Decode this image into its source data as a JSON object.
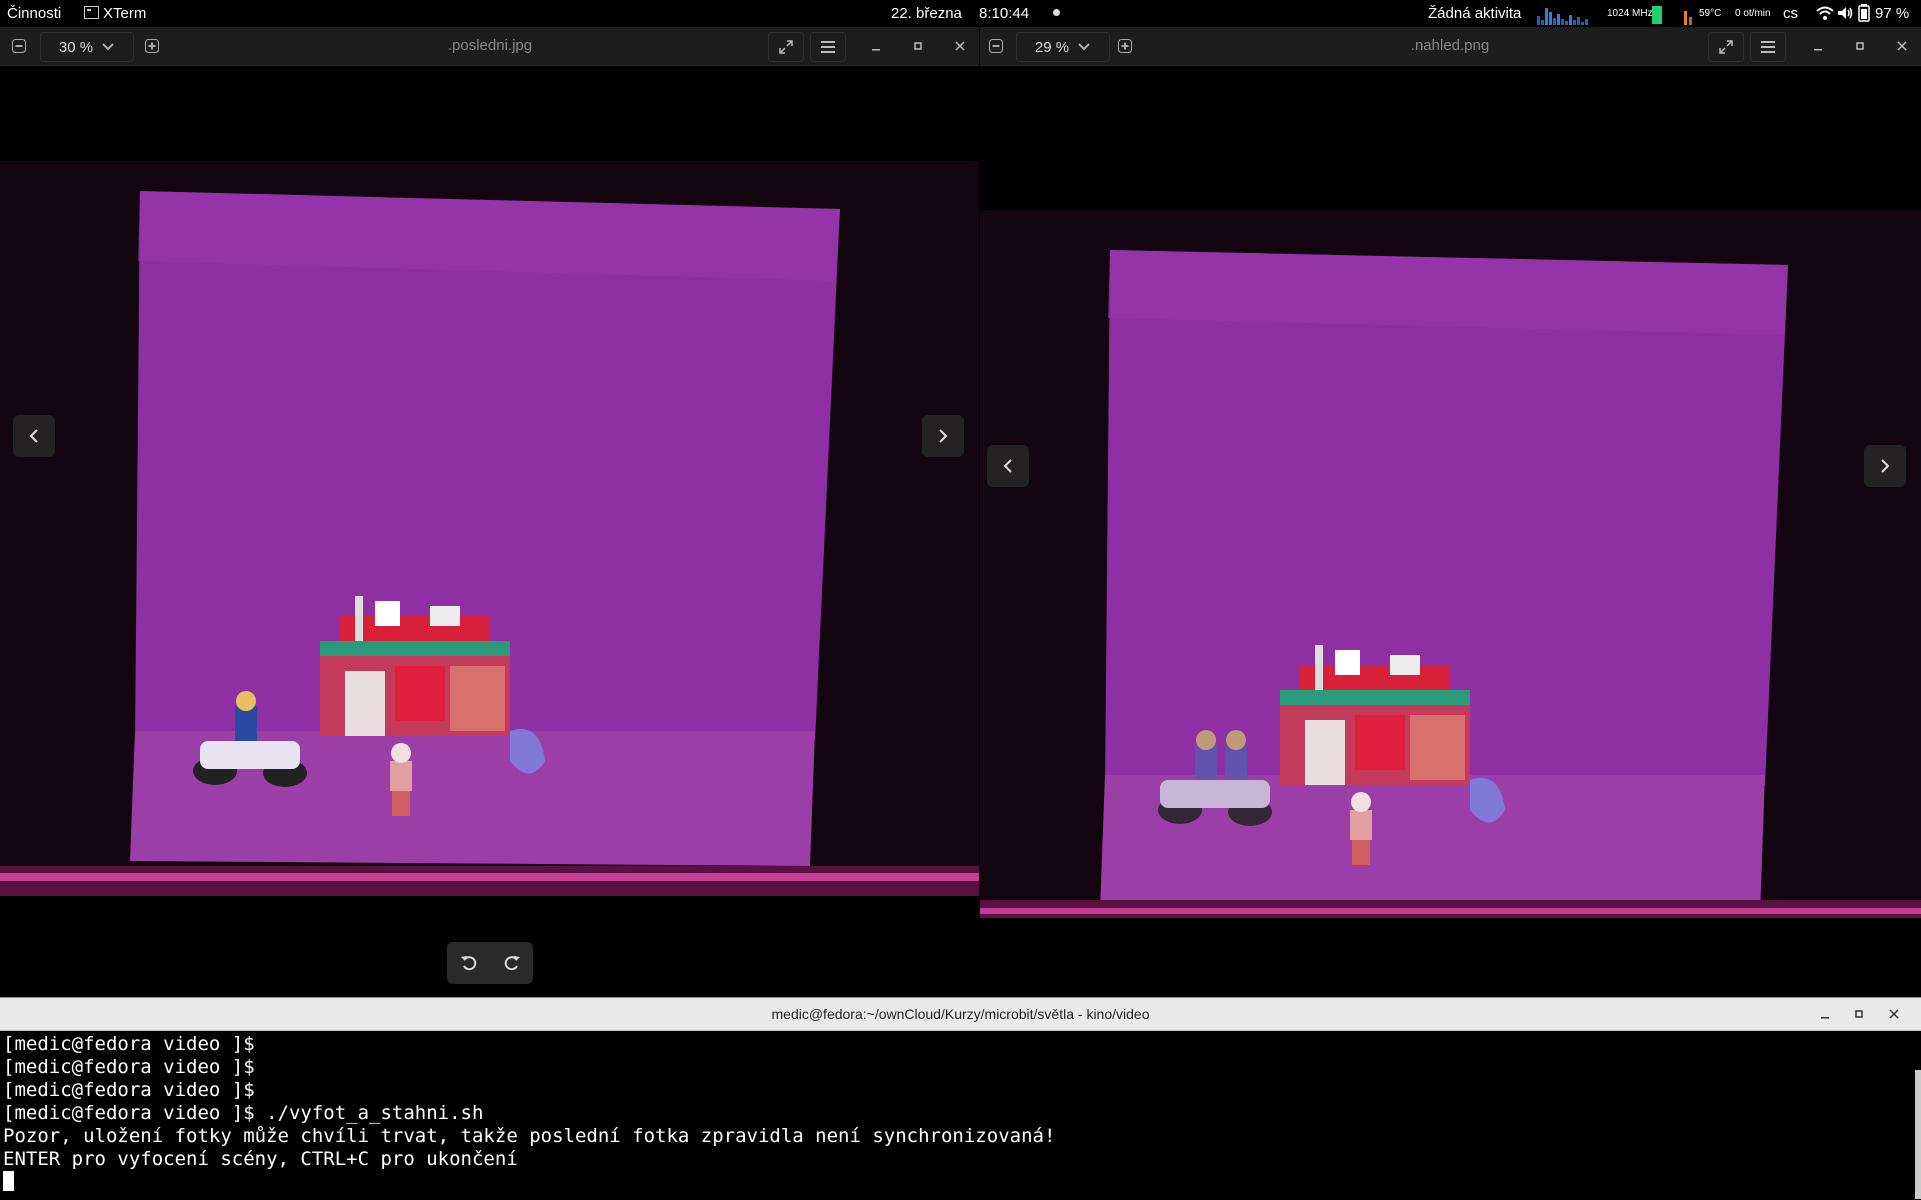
{
  "topbar": {
    "activities": "Činnosti",
    "app_name": "XTerm",
    "date": "22. března",
    "time": "8:10:44",
    "no_activity": "Žádná aktivita",
    "cpu_freq": "1024 MHz",
    "temperature": "59°C",
    "fan": "0 ot/min",
    "keyboard_layout": "cs",
    "battery": "97 %"
  },
  "viewers": [
    {
      "zoom": "30 %",
      "filename": ".posledni.jpg"
    },
    {
      "zoom": "29 %",
      "filename": ".nahled.png"
    }
  ],
  "terminal": {
    "title": "medic@fedora:~/ownCloud/Kurzy/microbit/světla - kino/video",
    "lines": [
      "[medic@fedora video ]$",
      "[medic@fedora video ]$",
      "[medic@fedora video ]$",
      "[medic@fedora video ]$ ./vyfot_a_stahni.sh",
      "Pozor, uložení fotky může chvíli trvat, takže poslední fotka zpravidla není synchronizovaná!",
      "ENTER pro vyfocení scény, CTRL+C pro ukončení"
    ]
  },
  "colors": {
    "backdrop": "#8a2a9e",
    "floor": "#9a3aa8",
    "topbar_bg": "#000000",
    "viewer_header": "#1d1d1d",
    "terminal_header": "#e9e9e9",
    "memory_bar": "#1fd16a"
  },
  "icons": [
    "xterm-icon",
    "recording-dot-icon",
    "cpu-graph-icon",
    "memory-bar-icon",
    "temperature-graph-icon",
    "wifi-icon",
    "volume-icon",
    "battery-icon",
    "zoom-out-icon",
    "chevron-down-icon",
    "zoom-in-icon",
    "fullscreen-icon",
    "hamburger-menu-icon",
    "minimize-icon",
    "maximize-icon",
    "close-icon",
    "arrow-left-icon",
    "arrow-right-icon",
    "rotate-left-icon",
    "rotate-right-icon"
  ]
}
